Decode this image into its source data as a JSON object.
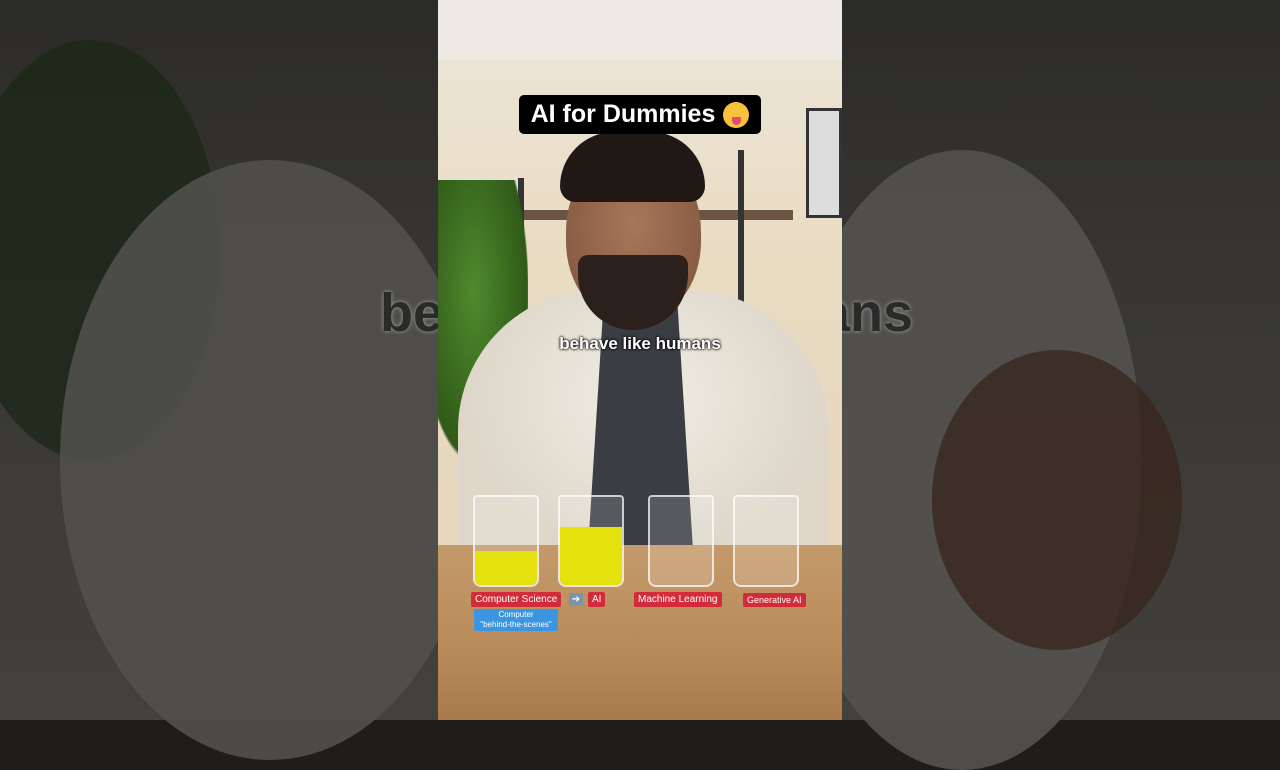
{
  "video": {
    "title": "AI for Dummies",
    "title_emoji": "zany-face-emoji",
    "caption": "behave like humans",
    "blurred_caption_left": "be",
    "blurred_caption_right": "ans",
    "labels": {
      "computer_science": "Computer Science",
      "arrow_icon": "right-arrow-icon",
      "ai": "AI",
      "computer_behind": "Computer",
      "behind_scenes": "\"behind-the-scenes\"",
      "machine_learning": "Machine Learning",
      "generative_ai": "Generative AI"
    },
    "colors": {
      "tag_red": "#d42b3a",
      "tag_blue": "#3b95e0"
    }
  }
}
